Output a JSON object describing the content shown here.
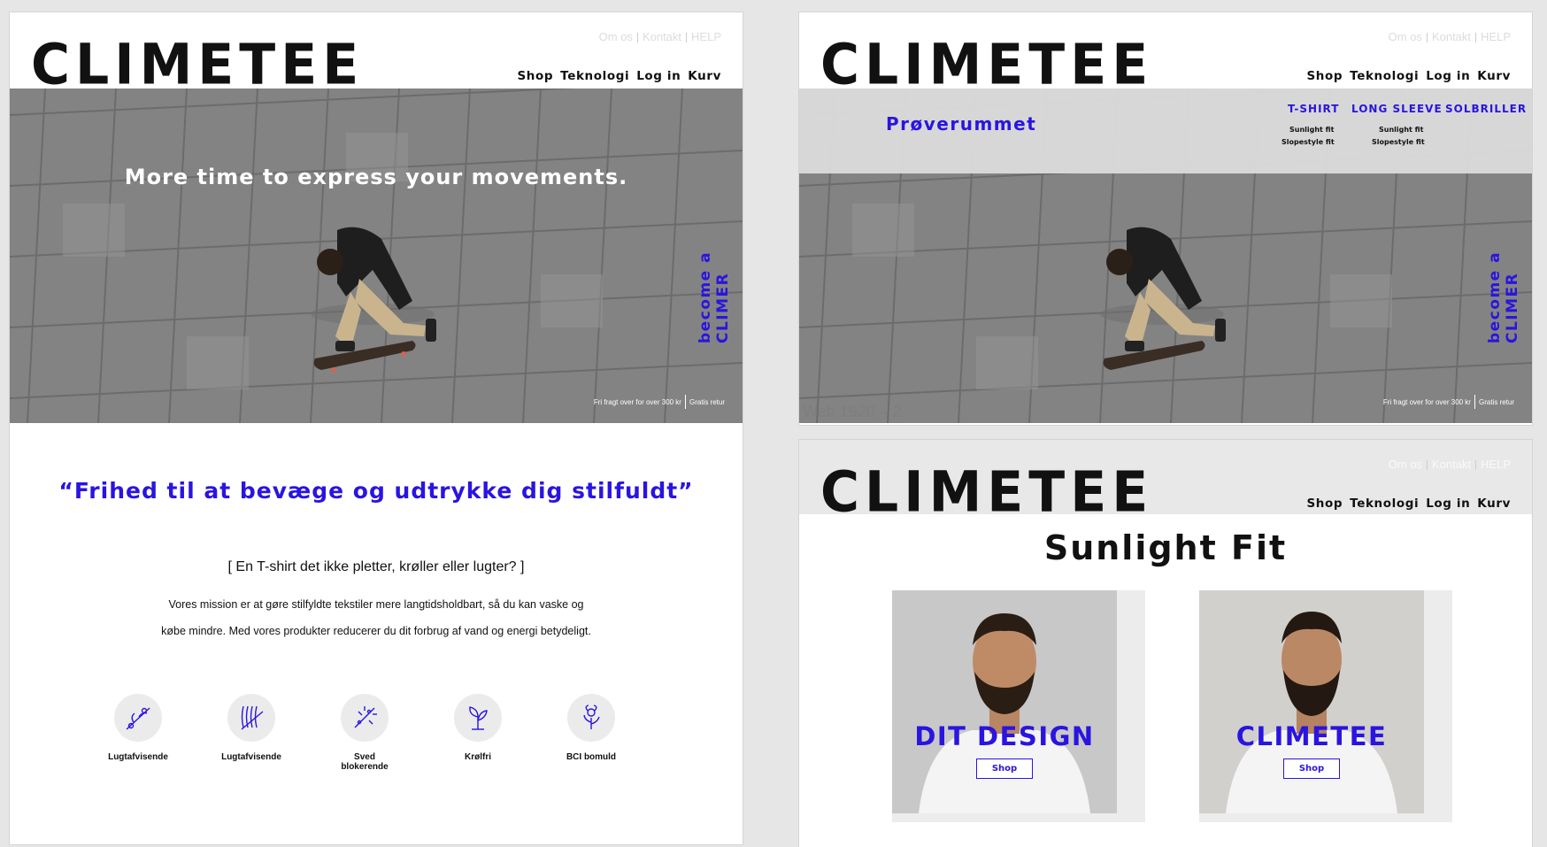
{
  "brand": "CLIMETEE",
  "colors": {
    "accent": "#2a14e0",
    "text": "#111111",
    "canvas": "#e6e6e6"
  },
  "top_nav": {
    "about": "Om os",
    "contact": "Kontakt",
    "help": "HELP"
  },
  "main_nav": {
    "shop": "Shop",
    "technology": "Teknologi",
    "login": "Log in",
    "cart": "Kurv"
  },
  "hero": {
    "headline": "More time to express your movements.",
    "vertical_cta": "become a CLIMER",
    "free_shipping": "Fri fragt over for over 300 kr",
    "free_return": "Gratis retur"
  },
  "home": {
    "quote": "“Frihed til at bevæge og udtrykke dig stilfuldt”",
    "question": "[ En T-shirt det ikke pletter, krøller eller lugter? ]",
    "mission_line1": "Vores mission er at gøre stilfyldte tekstiler mere langtidsholdbart, så du kan vaske og",
    "mission_line2": "købe mindre. Med vores produkter reducerer du dit forbrug af vand og energi betydeligt.",
    "features": [
      {
        "label": "Lugtafvisende",
        "icon": "branch-icon"
      },
      {
        "label": "Lugtafvisende",
        "icon": "fibers-icon"
      },
      {
        "label": "Sved blokerende",
        "icon": "sparkle-icon"
      },
      {
        "label": "Krølfri",
        "icon": "leaf-icon"
      },
      {
        "label": "BCI bomuld",
        "icon": "flower-icon"
      }
    ]
  },
  "dropdown": {
    "title": "Prøverummet",
    "categories": [
      "T-SHIRT",
      "LONG SLEEVE",
      "SOLBRILLER"
    ],
    "sub_tshirt": [
      "Sunlight fit",
      "Slopestyle fit"
    ],
    "sub_longsleeve": [
      "Sunlight fit",
      "Slopestyle fit"
    ]
  },
  "frame_label": "Web 1920 – 2",
  "product_page": {
    "title": "Sunlight Fit",
    "cards": [
      {
        "overlay": "DIT DESIGN",
        "button": "Shop"
      },
      {
        "overlay": "CLIMETEE",
        "button": "Shop"
      }
    ]
  }
}
